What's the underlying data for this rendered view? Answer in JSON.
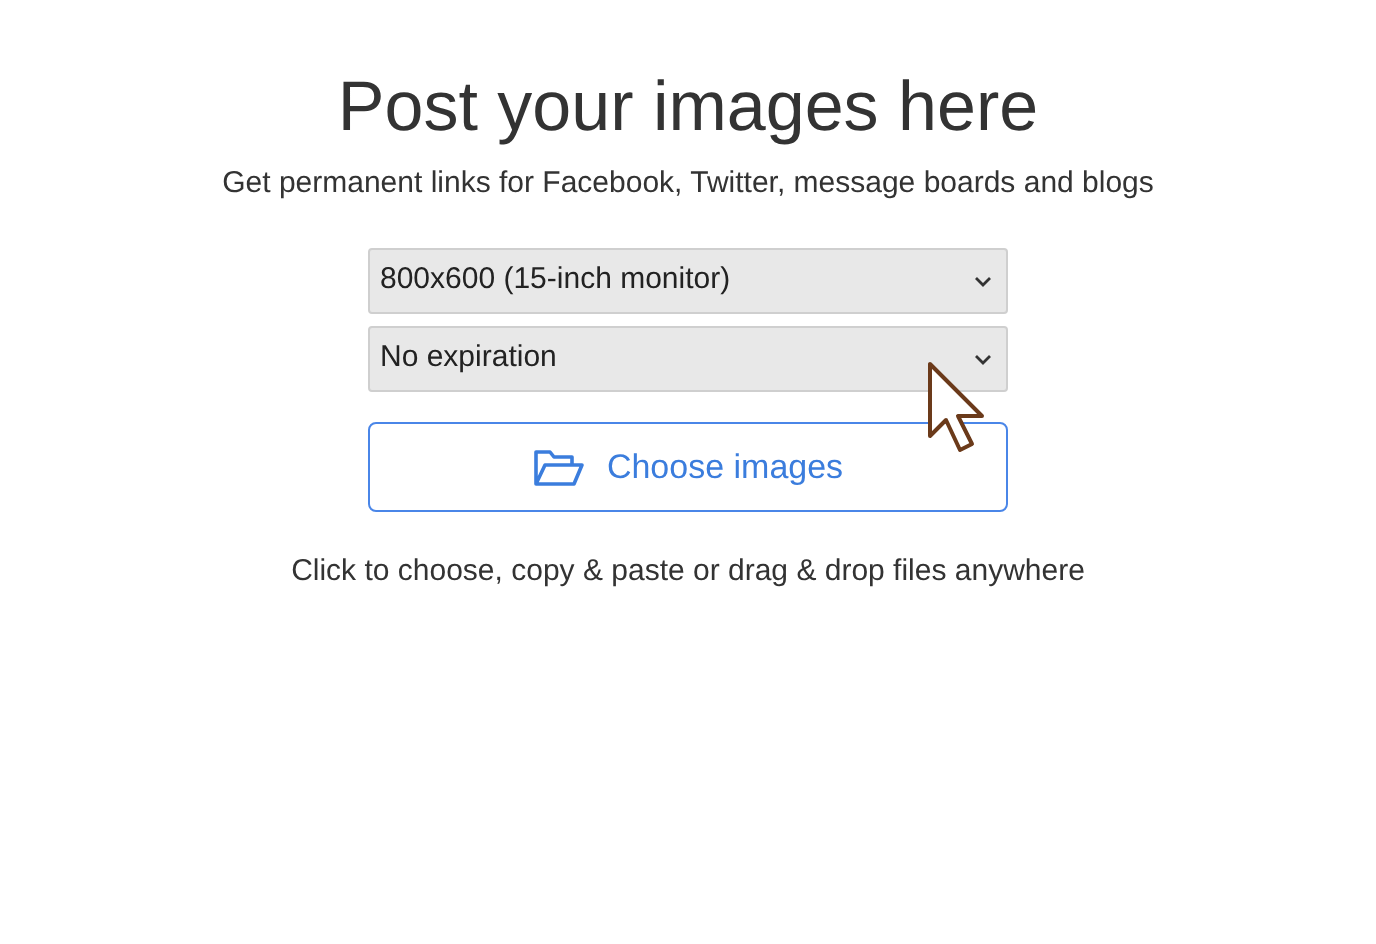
{
  "title": "Post your images here",
  "subtitle": "Get permanent links for Facebook, Twitter, message boards and blogs",
  "selects": [
    {
      "value": "800x600 (15-inch monitor)"
    },
    {
      "value": "No expiration"
    }
  ],
  "upload_button": {
    "label": "Choose images"
  },
  "hint": "Click to choose, copy & paste or drag & drop files anywhere"
}
